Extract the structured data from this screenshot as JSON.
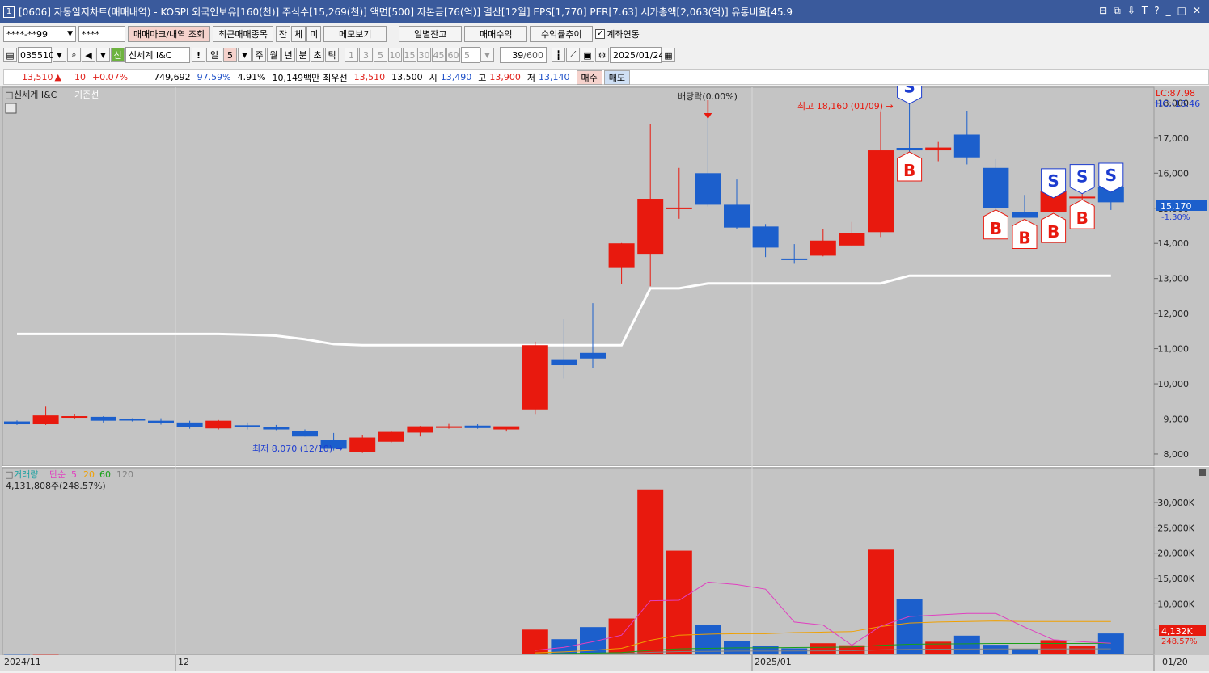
{
  "window": {
    "number": "1",
    "title": "[0606] 자동일지차트(매매내역) - KOSPI 외국인보유[160(천)] 주식수[15,269(천)] 액면[500] 자본금[76(억)] 결산[12월] EPS[1,770] PER[7.63] 시가총액[2,063(억)] 유통비율[45.9",
    "controls": [
      "⊟",
      "⧉",
      "⇩",
      "T",
      "?",
      "_",
      "□",
      "✕"
    ]
  },
  "toolbar1": {
    "account": "****-**99",
    "password": "****",
    "trade_mark_button": "매매마크/내역 조회",
    "recent_items_button": "최근매매종목",
    "filter_buttons": [
      "잔",
      "체",
      "미"
    ],
    "memo_button": "메모보기",
    "daily_balance_button": "일별잔고",
    "trade_profit_button": "매매수익",
    "return_trend_button": "수익률추이",
    "account_link_label": "계좌연동",
    "account_link_checked": true
  },
  "toolbar2": {
    "code": "035510",
    "market_badge": "신",
    "stock_name": "신세계 I&C",
    "period_buttons": [
      "일",
      "5",
      "주",
      "월",
      "년",
      "분",
      "초",
      "틱"
    ],
    "minute_buttons": [
      "1",
      "3",
      "5",
      "10",
      "15",
      "30",
      "45",
      "60"
    ],
    "minute_custom": "5",
    "count": "39",
    "count_max": "/600",
    "date": "2025/01/24"
  },
  "quote": {
    "price": "13,510",
    "arrow": "▲",
    "change": "10",
    "change_rate": "+0.07%",
    "volume": "749,692",
    "volume_ratio": "97.59%",
    "turnover": "4.91%",
    "amount": "10,149백만",
    "best_label": "최우선",
    "best_ask": "13,510",
    "best_bid": "13,500",
    "open_label": "시",
    "open": "13,490",
    "high_label": "고",
    "high": "13,900",
    "low_label": "저",
    "low": "13,140",
    "buy_button": "매수",
    "sell_button": "매도"
  },
  "price_panel": {
    "legend_name": "신세계 I&C",
    "legend_base": "기준선",
    "lc": "LC:87.98",
    "hc": "HC:-16.46",
    "current_price_tag": "15,170",
    "current_change_tag": "-1.30%",
    "dividend_label": "배당락(0.00%)",
    "high_label": "최고 18,160 (01/09) →",
    "low_label": "최저 8,070 (12/10) →",
    "y_ticks": [
      "18,000",
      "17,000",
      "16,000",
      "15,000",
      "14,000",
      "13,000",
      "12,000",
      "11,000",
      "10,000",
      "9,000",
      "8,000"
    ]
  },
  "volume_panel": {
    "legend_name": "거래량",
    "legend_ma": "단순",
    "legend_periods": [
      "5",
      "20",
      "60",
      "120"
    ],
    "info": "4,131,808주(248.57%)",
    "current_tag": "4,132K",
    "current_pct": "248.57%",
    "y_ticks": [
      "30,000K",
      "25,000K",
      "20,000K",
      "15,000K",
      "10,000K",
      "5,000K"
    ]
  },
  "x_labels": [
    "2024/11",
    "12",
    "2025/01",
    "01/20"
  ],
  "colors": {
    "up": "#e8190e",
    "down": "#1c5fcc",
    "baseline": "#ffffff",
    "ma5": "#e040c0",
    "ma20": "#f0a000",
    "ma60": "#18a018",
    "ma120": "#808080",
    "titlebar": "#3a5a9c"
  },
  "chart_data": {
    "type": "candlestick",
    "candles": [
      {
        "o": 8930,
        "h": 8960,
        "l": 8830,
        "c": 8850
      },
      {
        "o": 8850,
        "h": 9350,
        "l": 8830,
        "c": 9100
      },
      {
        "o": 9050,
        "h": 9150,
        "l": 9000,
        "c": 9080
      },
      {
        "o": 9060,
        "h": 9080,
        "l": 8900,
        "c": 8950
      },
      {
        "o": 9000,
        "h": 9020,
        "l": 8930,
        "c": 8960
      },
      {
        "o": 8950,
        "h": 9020,
        "l": 8840,
        "c": 8880
      },
      {
        "o": 8900,
        "h": 8950,
        "l": 8720,
        "c": 8760
      },
      {
        "o": 8730,
        "h": 8970,
        "l": 8700,
        "c": 8950
      },
      {
        "o": 8820,
        "h": 8900,
        "l": 8700,
        "c": 8780
      },
      {
        "o": 8780,
        "h": 8830,
        "l": 8680,
        "c": 8700
      },
      {
        "o": 8650,
        "h": 8700,
        "l": 8500,
        "c": 8500
      },
      {
        "o": 8400,
        "h": 8600,
        "l": 8100,
        "c": 8150
      },
      {
        "o": 8050,
        "h": 8550,
        "l": 8030,
        "c": 8470
      },
      {
        "o": 8350,
        "h": 8650,
        "l": 8330,
        "c": 8630
      },
      {
        "o": 8610,
        "h": 8800,
        "l": 8500,
        "c": 8790
      },
      {
        "o": 8760,
        "h": 8860,
        "l": 8720,
        "c": 8790
      },
      {
        "o": 8810,
        "h": 8850,
        "l": 8720,
        "c": 8740
      },
      {
        "o": 8700,
        "h": 8780,
        "l": 8640,
        "c": 8790
      },
      {
        "o": 9270,
        "h": 11200,
        "l": 9120,
        "c": 11100
      },
      {
        "o": 10700,
        "h": 11840,
        "l": 10150,
        "c": 10530
      },
      {
        "o": 10880,
        "h": 12300,
        "l": 10450,
        "c": 10720
      },
      {
        "o": 13300,
        "h": 14010,
        "l": 12840,
        "c": 14000
      },
      {
        "o": 13680,
        "h": 17400,
        "l": 12780,
        "c": 15270
      },
      {
        "o": 15000,
        "h": 16150,
        "l": 14700,
        "c": 15020
      },
      {
        "o": 16000,
        "h": 17700,
        "l": 15050,
        "c": 15100
      },
      {
        "o": 15100,
        "h": 15820,
        "l": 14400,
        "c": 14450
      },
      {
        "o": 14480,
        "h": 14550,
        "l": 13610,
        "c": 13880
      },
      {
        "o": 13570,
        "h": 13980,
        "l": 13420,
        "c": 13530
      },
      {
        "o": 13650,
        "h": 14400,
        "l": 13630,
        "c": 14080
      },
      {
        "o": 13940,
        "h": 14610,
        "l": 13930,
        "c": 14300
      },
      {
        "o": 14320,
        "h": 17740,
        "l": 14180,
        "c": 16650
      },
      {
        "o": 16720,
        "h": 18160,
        "l": 16600,
        "c": 16650
      },
      {
        "o": 16650,
        "h": 16890,
        "l": 16340,
        "c": 16730
      },
      {
        "o": 17100,
        "h": 17770,
        "l": 16250,
        "c": 16450
      },
      {
        "o": 16150,
        "h": 16400,
        "l": 14940,
        "c": 15000
      },
      {
        "o": 14900,
        "h": 15380,
        "l": 14730,
        "c": 14730
      },
      {
        "o": 14900,
        "h": 15480,
        "l": 14890,
        "c": 15480
      },
      {
        "o": 15290,
        "h": 15600,
        "l": 15090,
        "c": 15330
      },
      {
        "o": 15620,
        "h": 15640,
        "l": 14950,
        "c": 15170
      }
    ],
    "baseline": [
      11420,
      11420,
      11420,
      11420,
      11420,
      11420,
      11420,
      11420,
      11400,
      11370,
      11270,
      11130,
      11100,
      11100,
      11100,
      11100,
      11100,
      11100,
      11100,
      11100,
      11100,
      11100,
      12720,
      12720,
      12860,
      12860,
      12860,
      12860,
      12860,
      12860,
      12860,
      13080,
      13080,
      13080,
      13080,
      13080,
      13080,
      13080,
      13080
    ],
    "volume_k": [
      100,
      100,
      0,
      0,
      0,
      0,
      0,
      0,
      0,
      0,
      0,
      0,
      0,
      0,
      0,
      0,
      0,
      0,
      4900,
      3000,
      5400,
      7100,
      32600,
      20500,
      5900,
      2700,
      1600,
      1200,
      2200,
      1800,
      20700,
      10900,
      2500,
      3700,
      1900,
      1100,
      2800,
      1700,
      4132
    ],
    "ma5_k": [
      null,
      null,
      null,
      null,
      null,
      null,
      null,
      null,
      null,
      null,
      null,
      null,
      null,
      null,
      null,
      null,
      null,
      null,
      800,
      1400,
      2500,
      3800,
      10600,
      10700,
      14300,
      13800,
      12900,
      6400,
      5800,
      1800,
      5600,
      7500,
      7800,
      8100,
      8100,
      5400,
      2900,
      2500,
      2200
    ],
    "ma20_k": [
      null,
      null,
      null,
      null,
      null,
      null,
      null,
      null,
      null,
      null,
      null,
      null,
      null,
      null,
      null,
      null,
      null,
      null,
      300,
      500,
      800,
      1200,
      2800,
      3800,
      4000,
      4100,
      4100,
      4300,
      4400,
      4500,
      5500,
      6200,
      6400,
      6500,
      6600,
      6500,
      6500,
      6500,
      6500
    ],
    "ma60_k": [
      null,
      null,
      null,
      null,
      null,
      null,
      null,
      null,
      null,
      null,
      null,
      null,
      null,
      null,
      null,
      null,
      null,
      null,
      100,
      150,
      250,
      350,
      800,
      1100,
      1200,
      1300,
      1300,
      1350,
      1400,
      1450,
      1800,
      2000,
      2050,
      2100,
      2150,
      2150,
      2150,
      2150,
      2200
    ],
    "ma120_k": [
      null,
      null,
      null,
      null,
      null,
      null,
      null,
      null,
      null,
      null,
      null,
      null,
      null,
      null,
      null,
      null,
      null,
      null,
      50,
      80,
      120,
      180,
      400,
      550,
      600,
      650,
      650,
      680,
      700,
      720,
      900,
      1000,
      1030,
      1050,
      1080,
      1080,
      1080,
      1100,
      1100
    ],
    "trade_marks": [
      {
        "i": 31,
        "type": "S"
      },
      {
        "i": 31,
        "type": "B"
      },
      {
        "i": 34,
        "type": "B"
      },
      {
        "i": 35,
        "type": "B"
      },
      {
        "i": 36,
        "type": "S"
      },
      {
        "i": 36,
        "type": "B"
      },
      {
        "i": 37,
        "type": "S"
      },
      {
        "i": 37,
        "type": "B"
      },
      {
        "i": 38,
        "type": "S"
      }
    ],
    "price_ylim": [
      7700,
      18400
    ],
    "volume_ylim": [
      0,
      34000
    ]
  }
}
